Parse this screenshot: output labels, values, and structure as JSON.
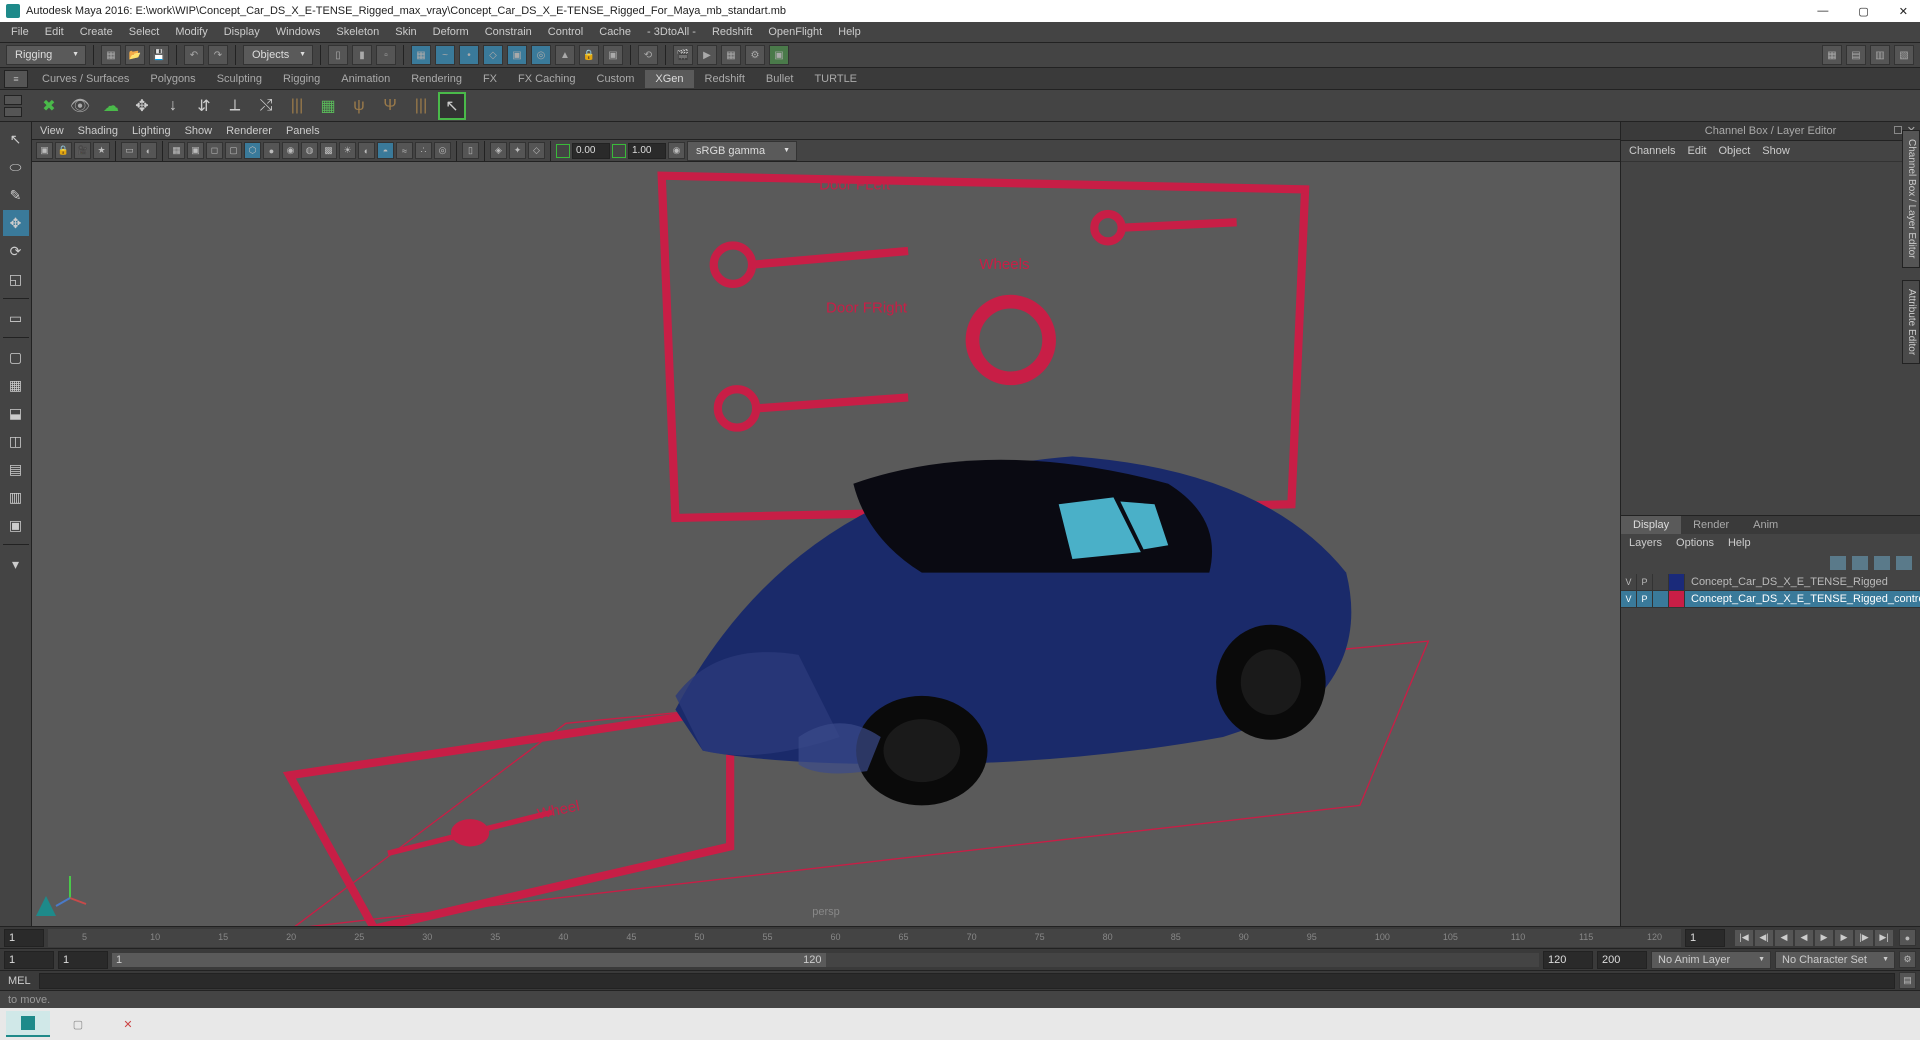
{
  "title": "Autodesk Maya 2016: E:\\work\\WIP\\Concept_Car_DS_X_E-TENSE_Rigged_max_vray\\Concept_Car_DS_X_E-TENSE_Rigged_For_Maya_mb_standart.mb",
  "menus": [
    "File",
    "Edit",
    "Create",
    "Select",
    "Modify",
    "Display",
    "Windows",
    "Skeleton",
    "Skin",
    "Deform",
    "Constrain",
    "Control",
    "Cache",
    "- 3DtoAll -",
    "Redshift",
    "OpenFlight",
    "Help"
  ],
  "workspace": "Rigging",
  "objects_label": "Objects",
  "shelf_tabs": [
    "Curves / Surfaces",
    "Polygons",
    "Sculpting",
    "Rigging",
    "Animation",
    "Rendering",
    "FX",
    "FX Caching",
    "Custom",
    "XGen",
    "Redshift",
    "Bullet",
    "TURTLE"
  ],
  "shelf_active": "XGen",
  "view_menus": [
    "View",
    "Shading",
    "Lighting",
    "Show",
    "Renderer",
    "Panels"
  ],
  "exposure": "0.00",
  "gamma": "1.00",
  "colorspace": "sRGB gamma",
  "viewport": {
    "camera": "persp",
    "labels": {
      "door_fl": "Door FLeft",
      "door_fr": "Door FRight",
      "wheels": "Wheels",
      "wheel": "Wheel"
    }
  },
  "channelbox": {
    "title": "Channel Box / Layer Editor",
    "menus": [
      "Channels",
      "Edit",
      "Object",
      "Show"
    ],
    "layer_tabs": [
      "Display",
      "Render",
      "Anim"
    ],
    "layer_tab_active": "Display",
    "layer_menus": [
      "Layers",
      "Options",
      "Help"
    ],
    "layers": [
      {
        "v": "V",
        "p": "P",
        "color": "#1a2a7a",
        "name": "Concept_Car_DS_X_E_TENSE_Rigged",
        "selected": false
      },
      {
        "v": "V",
        "p": "P",
        "color": "#c81e46",
        "name": "Concept_Car_DS_X_E_TENSE_Rigged_controllers",
        "selected": true
      }
    ]
  },
  "side_tabs": {
    "cb": "Channel Box / Layer Editor",
    "ae": "Attribute Editor"
  },
  "time": {
    "current": "1",
    "ticks": [
      "5",
      "10",
      "15",
      "20",
      "25",
      "30",
      "35",
      "40",
      "45",
      "50",
      "55",
      "60",
      "65",
      "70",
      "75",
      "80",
      "85",
      "90",
      "95",
      "100",
      "105",
      "110",
      "115",
      "120"
    ]
  },
  "range": {
    "start": "1",
    "playstart": "1",
    "playend": "120",
    "end": "120",
    "endfield": "200",
    "anim_layer": "No Anim Layer",
    "char_set": "No Character Set"
  },
  "cmd_label": "MEL",
  "helpline": "to move."
}
